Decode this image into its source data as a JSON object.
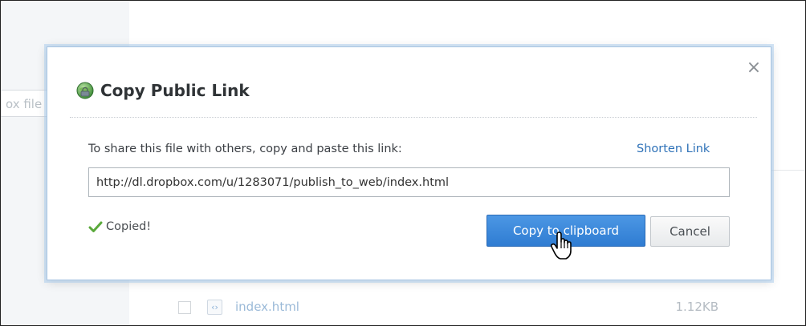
{
  "background": {
    "search_placeholder": "ox file",
    "file_row": {
      "name": "index.html",
      "size": "1.12KB",
      "icon": "code-file-icon"
    }
  },
  "dialog": {
    "title": "Copy Public Link",
    "title_icon": "globe-icon",
    "close_label": "×",
    "instructions": "To share this file with others, copy and paste this link:",
    "shorten_link": "Shorten Link",
    "link_value": "http://dl.dropbox.com/u/1283071/publish_to_web/index.html",
    "status": {
      "icon": "checkmark-icon",
      "text": "Copied!"
    },
    "buttons": {
      "copy": "Copy to clipboard",
      "cancel": "Cancel"
    }
  },
  "colors": {
    "accent": "#2f7cd2",
    "link": "#2f72b8",
    "success": "#5aa93b",
    "dialog_border": "#a7c4e2"
  }
}
